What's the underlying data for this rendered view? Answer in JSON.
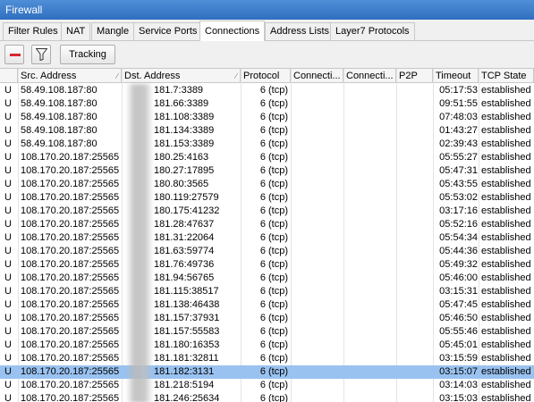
{
  "window": {
    "title": "Firewall"
  },
  "tabs": [
    {
      "label": "Filter Rules"
    },
    {
      "label": "NAT"
    },
    {
      "label": "Mangle"
    },
    {
      "label": "Service Ports"
    },
    {
      "label": "Connections",
      "active": true
    },
    {
      "label": "Address Lists"
    },
    {
      "label": "Layer7 Protocols"
    }
  ],
  "toolbar": {
    "remove_icon": "minus-icon",
    "filter_icon": "filter-icon",
    "tracking_label": "Tracking"
  },
  "columns": [
    "",
    "Src. Address",
    "Dst. Address",
    "Protocol",
    "Connecti...",
    "Connecti...",
    "P2P",
    "Timeout",
    "TCP State"
  ],
  "rows": [
    {
      "flag": "U",
      "src": "58.49.108.187:80",
      "dst": "181.7:3389",
      "proto": "6 (tcp)",
      "timeout": "05:17:53",
      "state": "established"
    },
    {
      "flag": "U",
      "src": "58.49.108.187:80",
      "dst": "181.66:3389",
      "proto": "6 (tcp)",
      "timeout": "09:51:55",
      "state": "established"
    },
    {
      "flag": "U",
      "src": "58.49.108.187:80",
      "dst": "181.108:3389",
      "proto": "6 (tcp)",
      "timeout": "07:48:03",
      "state": "established"
    },
    {
      "flag": "U",
      "src": "58.49.108.187:80",
      "dst": "181.134:3389",
      "proto": "6 (tcp)",
      "timeout": "01:43:27",
      "state": "established"
    },
    {
      "flag": "U",
      "src": "58.49.108.187:80",
      "dst": "181.153:3389",
      "proto": "6 (tcp)",
      "timeout": "02:39:43",
      "state": "established"
    },
    {
      "flag": "U",
      "src": "108.170.20.187:25565",
      "dst": "180.25:4163",
      "proto": "6 (tcp)",
      "timeout": "05:55:27",
      "state": "established"
    },
    {
      "flag": "U",
      "src": "108.170.20.187:25565",
      "dst": "180.27:17895",
      "proto": "6 (tcp)",
      "timeout": "05:47:31",
      "state": "established"
    },
    {
      "flag": "U",
      "src": "108.170.20.187:25565",
      "dst": "180.80:3565",
      "proto": "6 (tcp)",
      "timeout": "05:43:55",
      "state": "established"
    },
    {
      "flag": "U",
      "src": "108.170.20.187:25565",
      "dst": "180.119:27579",
      "proto": "6 (tcp)",
      "timeout": "05:53:02",
      "state": "established"
    },
    {
      "flag": "U",
      "src": "108.170.20.187:25565",
      "dst": "180.175:41232",
      "proto": "6 (tcp)",
      "timeout": "03:17:16",
      "state": "established"
    },
    {
      "flag": "U",
      "src": "108.170.20.187:25565",
      "dst": "181.28:47637",
      "proto": "6 (tcp)",
      "timeout": "05:52:16",
      "state": "established"
    },
    {
      "flag": "U",
      "src": "108.170.20.187:25565",
      "dst": "181.31:22064",
      "proto": "6 (tcp)",
      "timeout": "05:54:34",
      "state": "established"
    },
    {
      "flag": "U",
      "src": "108.170.20.187:25565",
      "dst": "181.63:59774",
      "proto": "6 (tcp)",
      "timeout": "05:44:36",
      "state": "established"
    },
    {
      "flag": "U",
      "src": "108.170.20.187:25565",
      "dst": "181.76:49736",
      "proto": "6 (tcp)",
      "timeout": "05:49:32",
      "state": "established"
    },
    {
      "flag": "U",
      "src": "108.170.20.187:25565",
      "dst": "181.94:56765",
      "proto": "6 (tcp)",
      "timeout": "05:46:00",
      "state": "established"
    },
    {
      "flag": "U",
      "src": "108.170.20.187:25565",
      "dst": "181.115:38517",
      "proto": "6 (tcp)",
      "timeout": "03:15:31",
      "state": "established"
    },
    {
      "flag": "U",
      "src": "108.170.20.187:25565",
      "dst": "181.138:46438",
      "proto": "6 (tcp)",
      "timeout": "05:47:45",
      "state": "established"
    },
    {
      "flag": "U",
      "src": "108.170.20.187:25565",
      "dst": "181.157:37931",
      "proto": "6 (tcp)",
      "timeout": "05:46:50",
      "state": "established"
    },
    {
      "flag": "U",
      "src": "108.170.20.187:25565",
      "dst": "181.157:55583",
      "proto": "6 (tcp)",
      "timeout": "05:55:46",
      "state": "established"
    },
    {
      "flag": "U",
      "src": "108.170.20.187:25565",
      "dst": "181.180:16353",
      "proto": "6 (tcp)",
      "timeout": "05:45:01",
      "state": "established"
    },
    {
      "flag": "U",
      "src": "108.170.20.187:25565",
      "dst": "181.181:32811",
      "proto": "6 (tcp)",
      "timeout": "03:15:59",
      "state": "established"
    },
    {
      "flag": "U",
      "src": "108.170.20.187:25565",
      "dst": "181.182:3131",
      "proto": "6 (tcp)",
      "timeout": "03:15:07",
      "state": "established",
      "selected": true
    },
    {
      "flag": "U",
      "src": "108.170.20.187:25565",
      "dst": "181.218:5194",
      "proto": "6 (tcp)",
      "timeout": "03:14:03",
      "state": "established"
    },
    {
      "flag": "U",
      "src": "108.170.20.187:25565",
      "dst": "181.246:25634",
      "proto": "6 (tcp)",
      "timeout": "03:15:03",
      "state": "established"
    }
  ],
  "colors": {
    "title_bar": "#3d7fd0",
    "selected_row": "#99c2f0",
    "remove_icon": "#d8262c"
  }
}
